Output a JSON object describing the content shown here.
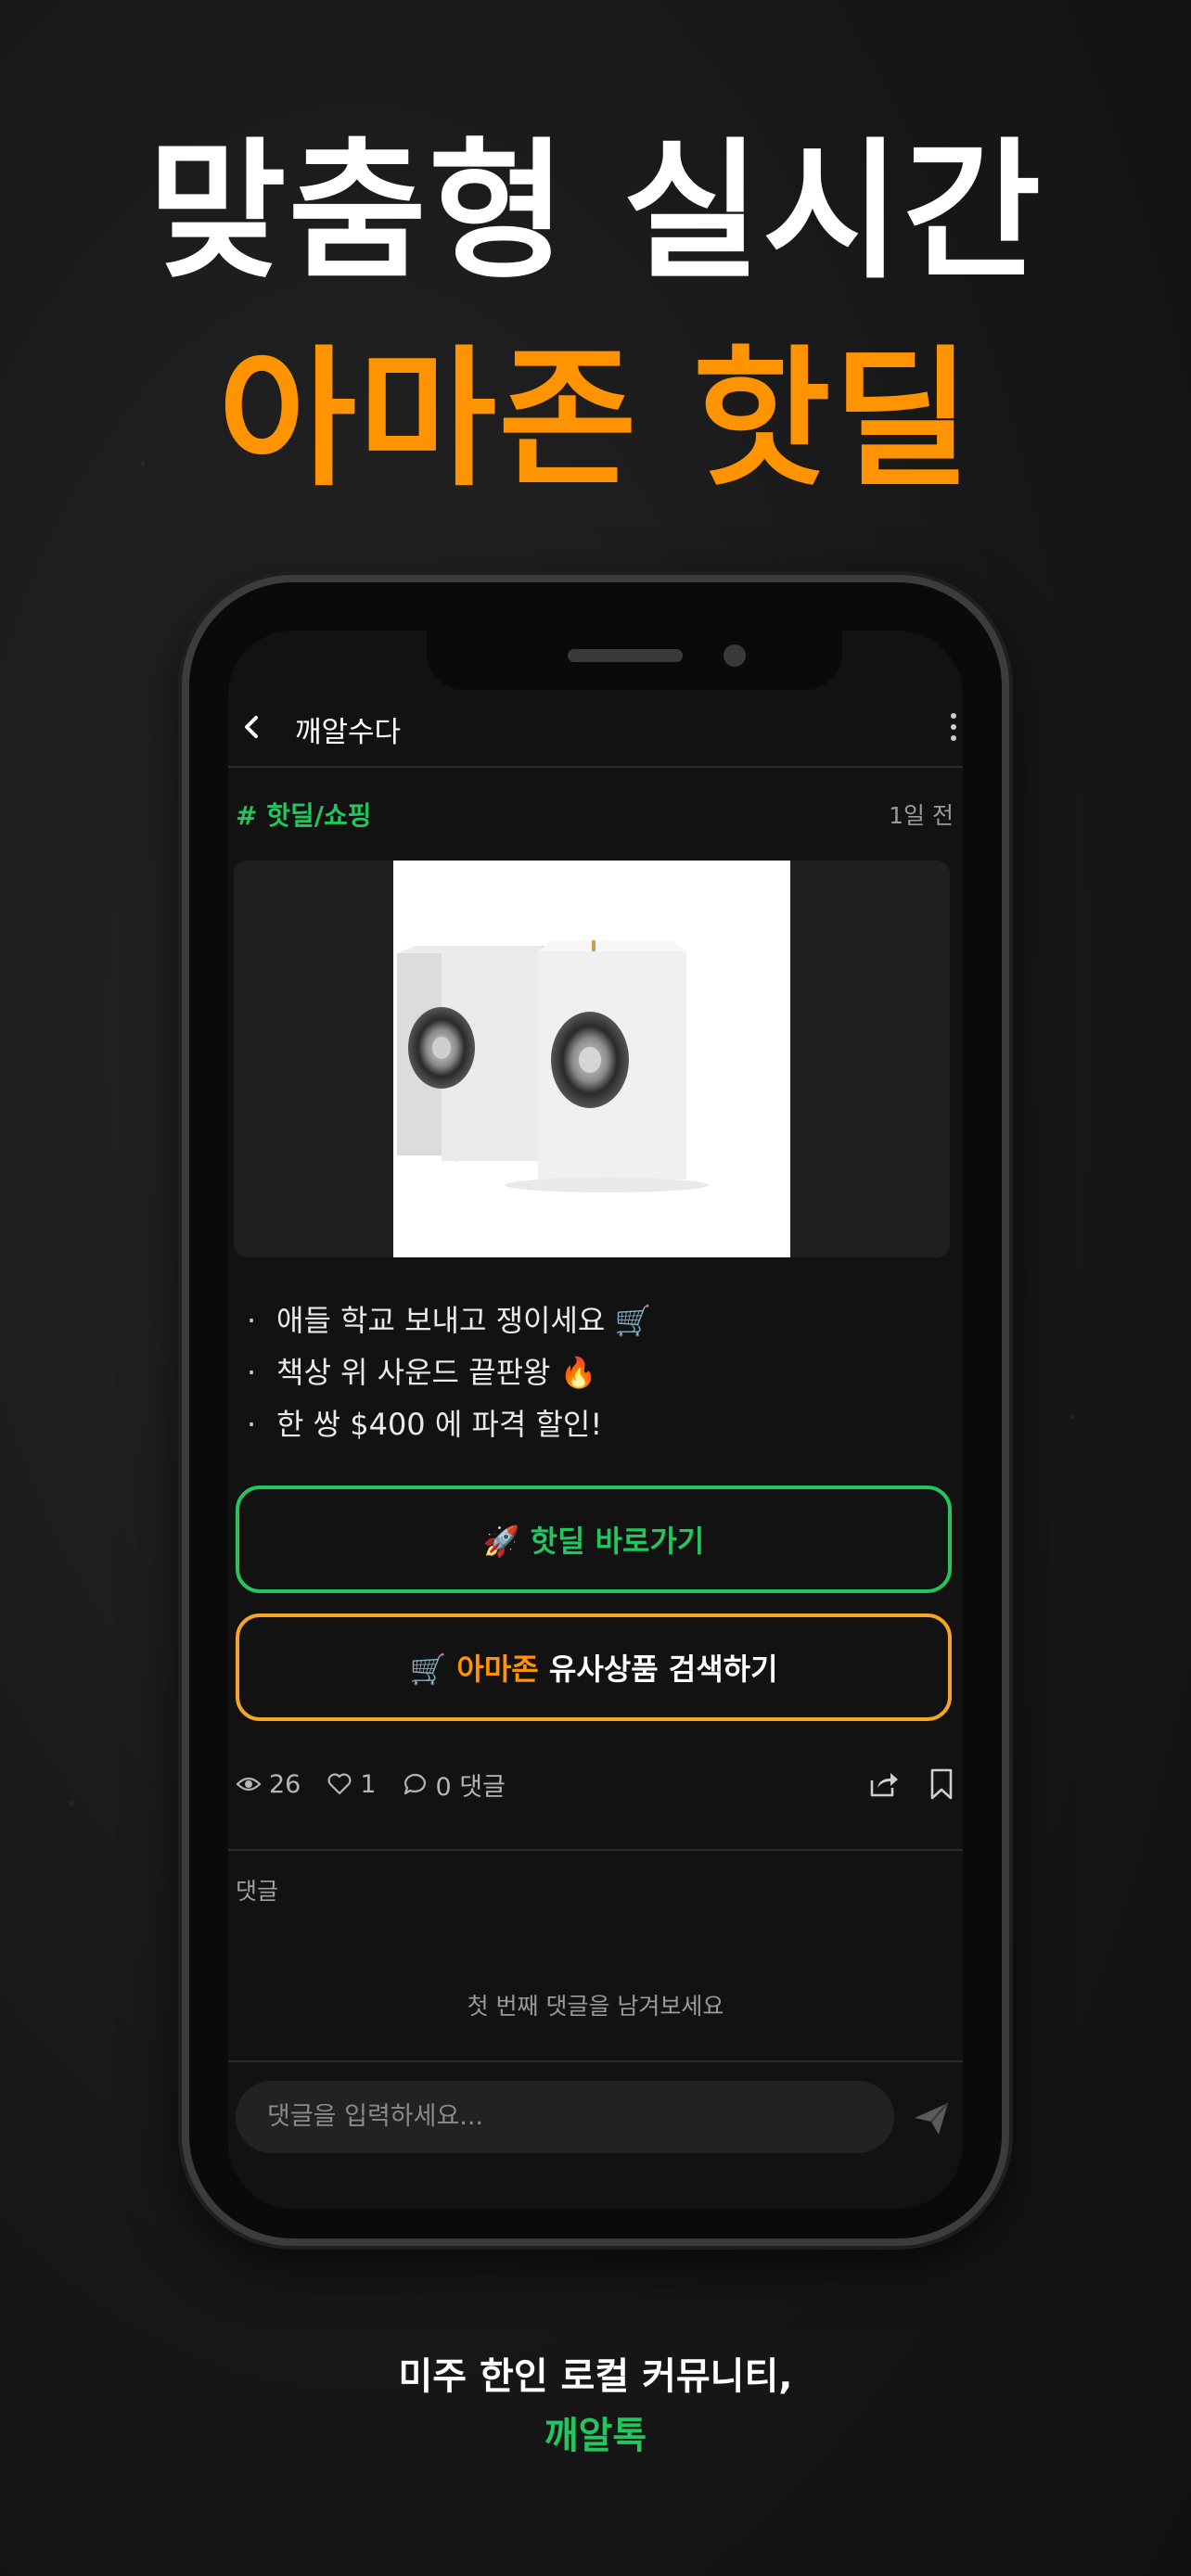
{
  "headline": {
    "line1": "맞춤형 실시간",
    "line2": "아마존 핫딜"
  },
  "appbar": {
    "title": "깨알수다",
    "back_icon": "chevron-left-icon",
    "more_icon": "kebab-menu-icon"
  },
  "post": {
    "tag": "# 핫딜/쇼핑",
    "time": "1일 전",
    "image": "white-bookshelf-speakers",
    "bullets": [
      "애들 학교 보내고 쟁이세요 🛒",
      "책상 위 사운드 끝판왕 🔥",
      "한 쌍 $400 에 파격 할인!"
    ],
    "deal_button": {
      "emoji": "🚀",
      "label": "핫딜 바로가기"
    },
    "amazon_button": {
      "emoji": "🛒",
      "highlight": "아마존",
      "label": "유사상품 검색하기"
    },
    "stats": {
      "views": "26",
      "likes": "1",
      "comments": "0 댓글"
    }
  },
  "comments": {
    "label": "댓글",
    "empty_text": "첫 번째 댓글을 남겨보세요",
    "input_placeholder": "댓글을 입력하세요..."
  },
  "tagline": {
    "line1": "미주 한인 로컬 커뮤니티,",
    "line2": "깨알톡"
  },
  "colors": {
    "accent_green": "#22c55e",
    "accent_orange": "#ff9400",
    "background": "#121212"
  }
}
